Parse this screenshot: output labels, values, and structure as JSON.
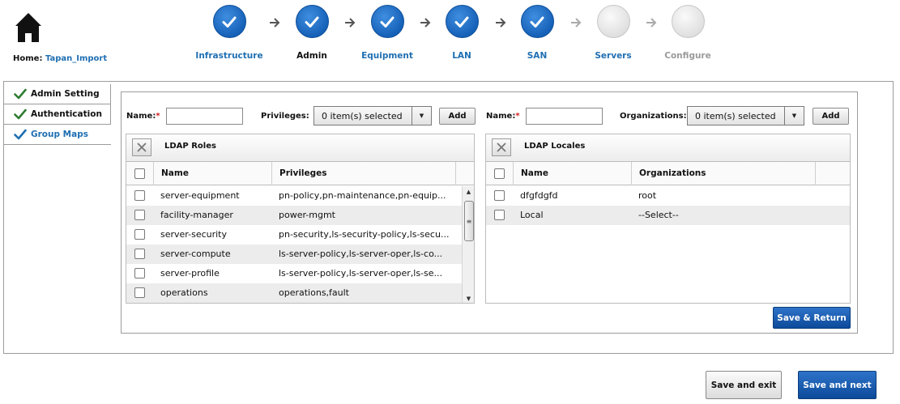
{
  "home": {
    "prefix": "Home:",
    "link": "Tapan_Import"
  },
  "steps": [
    {
      "label": "Infrastructure",
      "state": "done"
    },
    {
      "label": "Admin",
      "state": "current"
    },
    {
      "label": "Equipment",
      "state": "done"
    },
    {
      "label": "LAN",
      "state": "done"
    },
    {
      "label": "SAN",
      "state": "done"
    },
    {
      "label": "Servers",
      "state": "todo"
    },
    {
      "label": "Configure",
      "state": "todo"
    }
  ],
  "sidebar": {
    "items": [
      {
        "label": "Admin Setting"
      },
      {
        "label": "Authentication"
      },
      {
        "label": "Group Maps"
      }
    ]
  },
  "roles_form": {
    "name_label": "Name:",
    "required_mark": "*",
    "name_value": "",
    "privileges_label": "Privileges:",
    "privileges_selected": "0 item(s) selected",
    "add_label": "Add"
  },
  "locales_form": {
    "name_label": "Name:",
    "required_mark": "*",
    "name_value": "",
    "organizations_label": "Organizations:",
    "organizations_selected": "0 item(s) selected",
    "add_label": "Add"
  },
  "roles_grid": {
    "title": "LDAP Roles",
    "columns": [
      "Name",
      "Privileges"
    ],
    "rows": [
      {
        "name": "server-equipment",
        "privileges": "pn-policy,pn-maintenance,pn-equip..."
      },
      {
        "name": "facility-manager",
        "privileges": "power-mgmt"
      },
      {
        "name": "server-security",
        "privileges": "pn-security,ls-security-policy,ls-secu..."
      },
      {
        "name": "server-compute",
        "privileges": "ls-server-policy,ls-server-oper,ls-co..."
      },
      {
        "name": "server-profile",
        "privileges": "ls-server-policy,ls-server-oper,ls-se..."
      },
      {
        "name": "operations",
        "privileges": "operations,fault"
      }
    ]
  },
  "locales_grid": {
    "title": "LDAP Locales",
    "columns": [
      "Name",
      "Organizations"
    ],
    "rows": [
      {
        "name": "dfgfdgfd",
        "organizations": "root"
      },
      {
        "name": "Local",
        "organizations": "--Select--"
      }
    ]
  },
  "buttons": {
    "save_return": "Save & Return",
    "save_exit": "Save and exit",
    "save_next": "Save and next"
  },
  "colors": {
    "link_blue": "#1f6fb2",
    "primary_button": "#1657ad",
    "check_green": "#2e7d32",
    "required_red": "#d42020"
  }
}
